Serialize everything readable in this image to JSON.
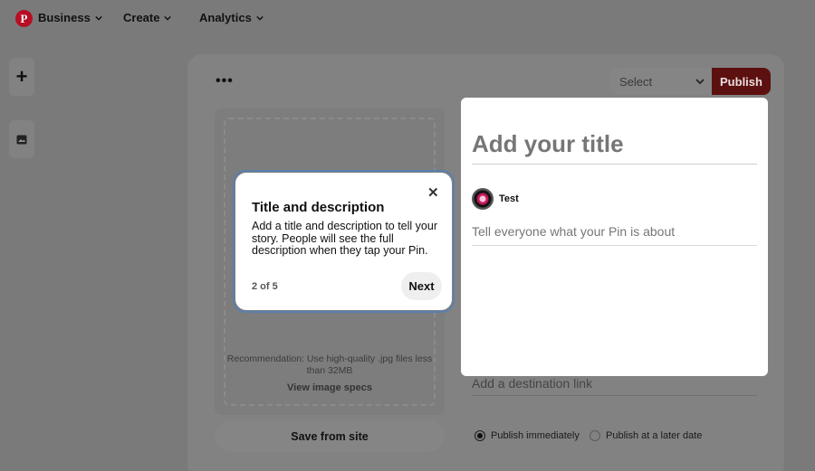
{
  "nav": {
    "logo_glyph": "P",
    "items": [
      {
        "label": "Business"
      },
      {
        "label": "Create"
      },
      {
        "label": "Analytics"
      }
    ]
  },
  "rail": {
    "add_glyph": "+"
  },
  "toolbar": {
    "more_glyph": "•••",
    "select_value": "Select",
    "publish_label": "Publish"
  },
  "upload": {
    "recommendation": "Recommendation: Use high-quality .jpg files less than 32MB",
    "specs_link": "View image specs",
    "save_from_site": "Save from site"
  },
  "editor": {
    "title_placeholder": "Add your title",
    "username": "Test",
    "description_placeholder": "Tell everyone what your Pin is about",
    "destination_placeholder": "Add a destination link"
  },
  "publish_options": {
    "immediately": "Publish immediately",
    "later": "Publish at a later date",
    "selected": "immediately"
  },
  "tooltip": {
    "close_glyph": "✕",
    "title": "Title and description",
    "body": "Add a title and description to tell your story. People will see the full description when they tap your Pin.",
    "step": "2 of 5",
    "next_label": "Next"
  },
  "colors": {
    "brand_red": "#b80d24",
    "overlay": "#7a7a7a",
    "tooltip_outline": "#5a7fb0"
  }
}
